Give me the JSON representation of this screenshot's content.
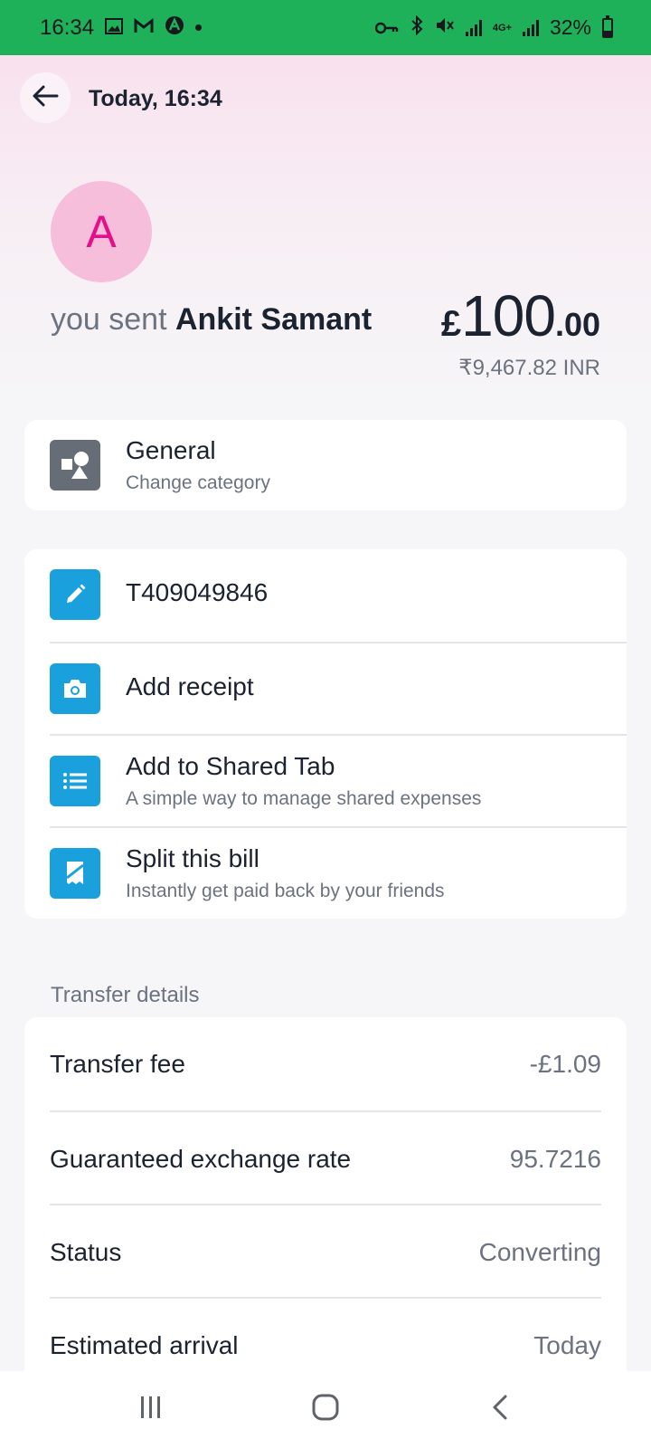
{
  "status_bar": {
    "time": "16:34",
    "left_icons": [
      "gallery-icon",
      "gmail-icon",
      "app-icon"
    ],
    "network_label": "4G+",
    "battery": "32%"
  },
  "header": {
    "title": "Today, 16:34"
  },
  "transaction": {
    "avatar_initial": "A",
    "prefix": "you sent",
    "recipient": "Ankit Samant",
    "currency_symbol": "£",
    "amount_major": "100",
    "amount_minor": ".00",
    "converted": "₹9,467.82 INR"
  },
  "category": {
    "title": "General",
    "subtitle": "Change category"
  },
  "actions": [
    {
      "title": "T409049846",
      "subtitle": ""
    },
    {
      "title": "Add receipt",
      "subtitle": ""
    },
    {
      "title": "Add to Shared Tab",
      "subtitle": "A simple way to manage shared expenses"
    },
    {
      "title": "Split this bill",
      "subtitle": "Instantly get paid back by your friends"
    }
  ],
  "transfer_details": {
    "heading": "Transfer details",
    "rows": [
      {
        "label": "Transfer fee",
        "value": "-£1.09"
      },
      {
        "label": "Guaranteed exchange rate",
        "value": "95.7216"
      },
      {
        "label": "Status",
        "value": "Converting"
      },
      {
        "label": "Estimated arrival",
        "value": "Today"
      }
    ]
  },
  "colors": {
    "status_bar": "#1fb05a",
    "accent_pink": "#e4108a",
    "icon_blue": "#1aa0dc"
  }
}
